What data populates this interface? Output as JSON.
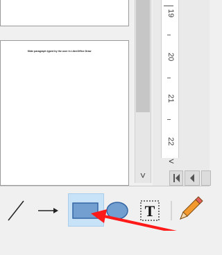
{
  "slide": {
    "text": "Slide paragraph typed by the user in LibreOffice Draw"
  },
  "ruler": {
    "labels": [
      "19",
      "20",
      "21",
      "22"
    ]
  },
  "scrollbar": {
    "down_arrow": "˅"
  },
  "navigation": {
    "left_arrow": "<"
  },
  "toolbar": {
    "tools": [
      "line",
      "arrow",
      "rectangle",
      "ellipse",
      "text",
      "pencil"
    ],
    "active_tool": "rectangle"
  },
  "colors": {
    "accent_highlight": "#c8e2f7",
    "rectangle_fill": "#729fcf",
    "rectangle_stroke": "#3465a4",
    "annotation_arrow": "#ff1a1a",
    "pencil_orange": "#f29a2e"
  }
}
